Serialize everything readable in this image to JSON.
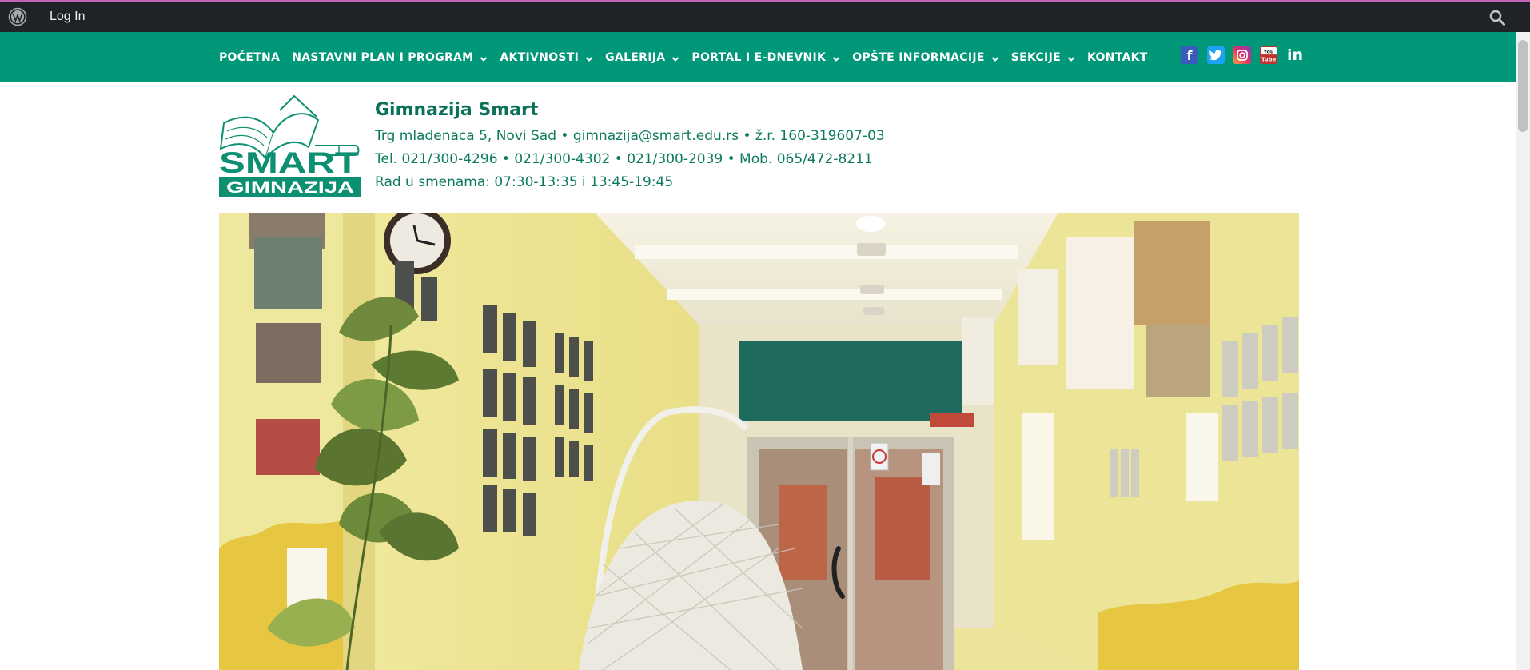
{
  "adminbar": {
    "login_label": "Log In"
  },
  "nav": {
    "items": [
      {
        "label": "POČETNA",
        "has_dropdown": false
      },
      {
        "label": "NASTAVNI PLAN I PROGRAM",
        "has_dropdown": true
      },
      {
        "label": "AKTIVNOSTI",
        "has_dropdown": true
      },
      {
        "label": "GALERIJA",
        "has_dropdown": true
      },
      {
        "label": "PORTAL I E-DNEVNIK",
        "has_dropdown": true
      },
      {
        "label": "OPŠTE INFORMACIJE",
        "has_dropdown": true
      },
      {
        "label": "SEKCIJE",
        "has_dropdown": true
      },
      {
        "label": "KONTAKT",
        "has_dropdown": false
      }
    ],
    "socials": {
      "facebook": "f",
      "twitter": "t",
      "instagram": "instagram-icon",
      "youtube": "You",
      "linkedin": "in"
    }
  },
  "logo": {
    "word1": "SMART",
    "word2": "GIMNAZIJA"
  },
  "header": {
    "name": "Gimnazija Smart",
    "address": "Trg mladenaca 5, Novi Sad • gimnazija@smart.edu.rs • ž.r. 160-319607-03",
    "phones": "Tel. 021/300-4296 • 021/300-4302 • 021/300-2039 • Mob. 065/472-8211",
    "hours": "Rad u smenama: 07:30-13:35 i 13:45-19:45"
  },
  "colors": {
    "adminbar_bg": "#1d2327",
    "nav_bg": "#009879",
    "brand_green": "#0d7a5f"
  }
}
